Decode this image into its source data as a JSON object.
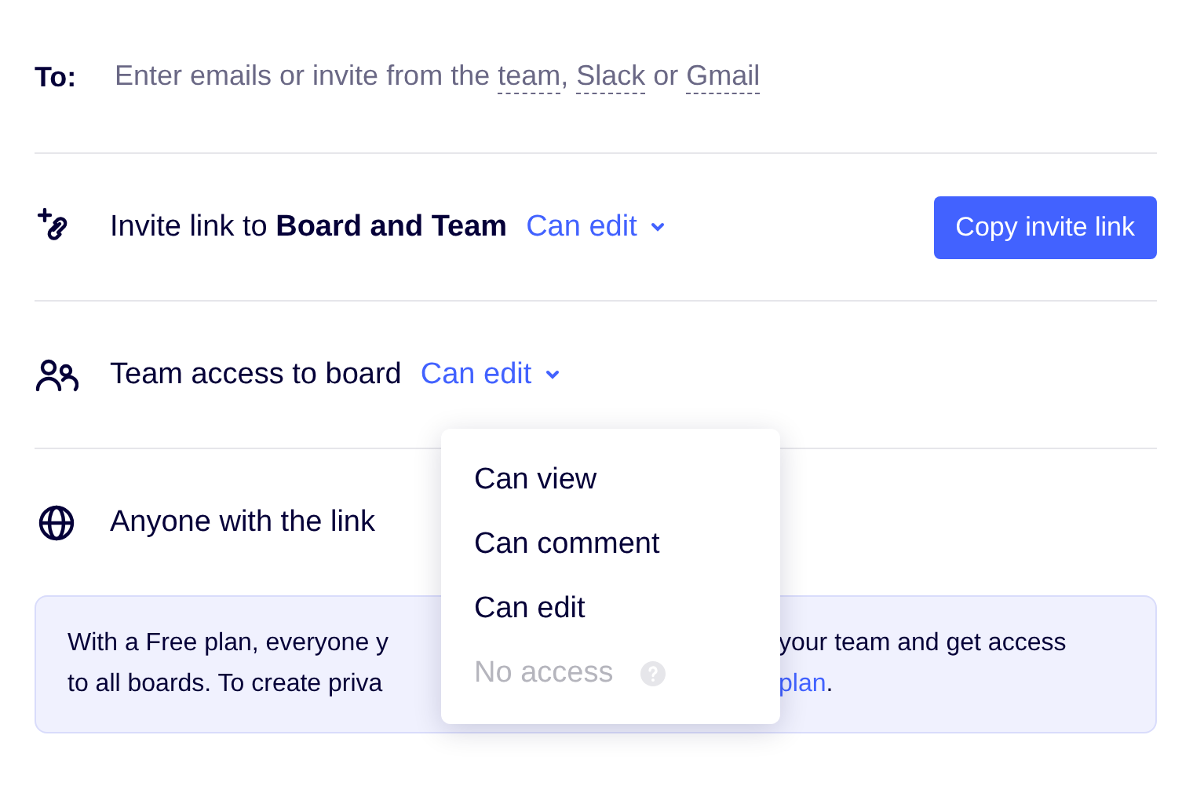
{
  "to_field": {
    "label": "To:",
    "placeholder_parts": [
      {
        "text": "Enter emails or invite from the ",
        "kind": "plain"
      },
      {
        "text": "team",
        "kind": "link"
      },
      {
        "text": ", ",
        "kind": "plain"
      },
      {
        "text": "Slack",
        "kind": "link"
      },
      {
        "text": " or ",
        "kind": "plain"
      },
      {
        "text": "Gmail",
        "kind": "link"
      }
    ]
  },
  "rows": [
    {
      "kind": "invite",
      "label": "Invite link to **Board and Team**",
      "permission": "Can edit",
      "button": "Copy invite link"
    },
    {
      "kind": "team",
      "label": "Team access to board",
      "permission": "Can edit"
    },
    {
      "kind": "anyone",
      "label": "Anyone with the link"
    }
  ],
  "notice": {
    "lines": [
      {
        "left": "With a Free plan, everyone y",
        "right": "your team and get access"
      },
      {
        "left": "to all boards. To create priva",
        "right_link": "plan",
        "right": "."
      }
    ]
  },
  "menu": {
    "items": [
      {
        "label": "Can view",
        "disabled": false
      },
      {
        "label": "Can comment",
        "disabled": false
      },
      {
        "label": "Can edit",
        "disabled": false
      },
      {
        "label": "No access",
        "disabled": true,
        "help": true
      }
    ]
  }
}
